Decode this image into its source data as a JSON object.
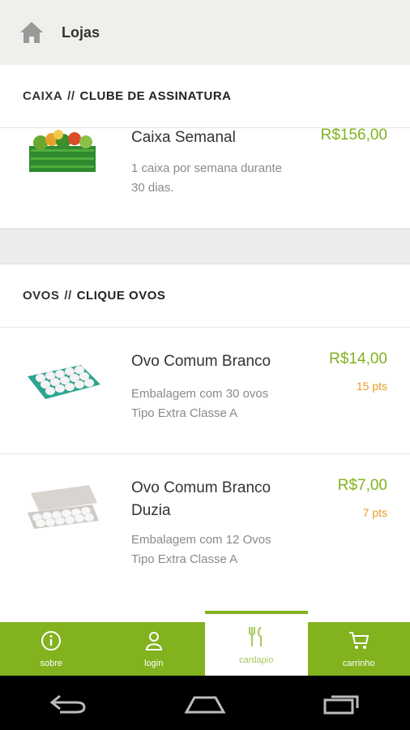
{
  "header": {
    "title": "Lojas"
  },
  "sections": [
    {
      "category": "CAIXA",
      "separator": "//",
      "subtitle": "CLUBE DE ASSINATURA",
      "products": [
        {
          "name": "Caixa Semanal",
          "desc": "1 caixa por semana durante 30 dias.",
          "price": "R$156,00",
          "points": ""
        }
      ]
    },
    {
      "category": "OVOS",
      "separator": "//",
      "subtitle": "CLIQUE OVOS",
      "products": [
        {
          "name": "Ovo Comum Branco",
          "desc": "Embalagem com 30 ovos Tipo Extra Classe A",
          "price": "R$14,00",
          "points": "15 pts"
        },
        {
          "name": "Ovo Comum Branco Duzia",
          "desc": "Embalagem com 12 Ovos Tipo Extra Classe A",
          "price": "R$7,00",
          "points": "7 pts"
        }
      ]
    }
  ],
  "bottom_nav": [
    {
      "label": "sobre",
      "icon": "info-icon"
    },
    {
      "label": "login",
      "icon": "user-icon"
    },
    {
      "label": "cardapio",
      "icon": "cutlery-icon",
      "active": true
    },
    {
      "label": "carrinho",
      "icon": "cart-icon"
    }
  ],
  "colors": {
    "accent": "#82b21e",
    "points": "#e99b2a"
  }
}
